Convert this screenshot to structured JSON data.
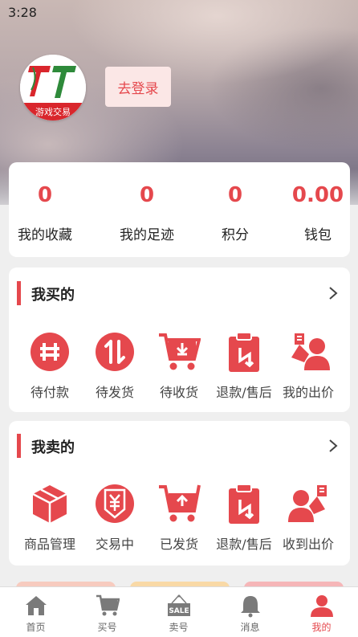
{
  "status_bar": {
    "time": "3:28"
  },
  "profile": {
    "logo_text": "游戏交易",
    "login_label": "去登录"
  },
  "stats": [
    {
      "value": "0",
      "label": "我的收藏"
    },
    {
      "value": "0",
      "label": "我的足迹"
    },
    {
      "value": "0",
      "label": "积分"
    },
    {
      "value": "0.00",
      "label": "钱包"
    }
  ],
  "buy_section": {
    "title": "我买的",
    "items": [
      {
        "label": "待付款",
        "icon": "pending-payment-icon"
      },
      {
        "label": "待发货",
        "icon": "pending-shipment-icon"
      },
      {
        "label": "待收货",
        "icon": "pending-receipt-icon"
      },
      {
        "label": "退款/售后",
        "icon": "refund-icon"
      },
      {
        "label": "我的出价",
        "icon": "my-bids-icon"
      }
    ]
  },
  "sell_section": {
    "title": "我卖的",
    "items": [
      {
        "label": "商品管理",
        "icon": "product-management-icon"
      },
      {
        "label": "交易中",
        "icon": "trading-icon"
      },
      {
        "label": "已发货",
        "icon": "shipped-icon"
      },
      {
        "label": "退款/售后",
        "icon": "refund-icon"
      },
      {
        "label": "收到出价",
        "icon": "received-bids-icon"
      }
    ]
  },
  "tabbar": {
    "tabs": [
      {
        "label": "首页",
        "icon": "home-icon"
      },
      {
        "label": "买号",
        "icon": "cart-icon"
      },
      {
        "label": "卖号",
        "icon": "sale-sign-icon",
        "badge_text": "SALE"
      },
      {
        "label": "消息",
        "icon": "bell-icon"
      },
      {
        "label": "我的",
        "icon": "user-icon",
        "active": true
      }
    ]
  },
  "colors": {
    "accent": "#e5484d",
    "accent_light": "#fbe7e6",
    "tab_inactive": "#7a7a7a",
    "promo_1": "#f7cbbf",
    "promo_2": "#f9d9a6",
    "promo_3": "#f6b6b8"
  }
}
